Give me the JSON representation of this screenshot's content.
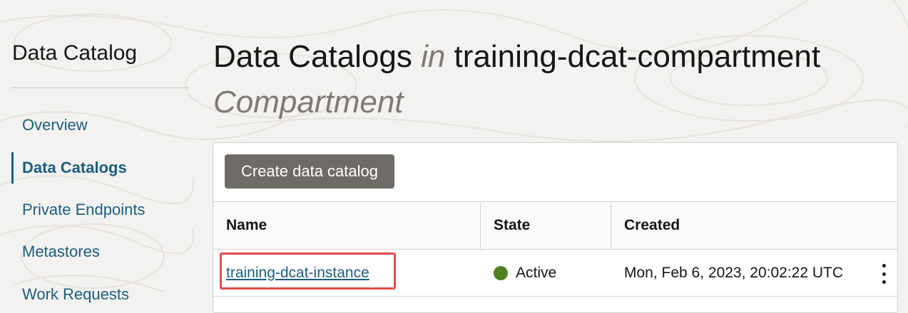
{
  "sidebar": {
    "title": "Data Catalog",
    "items": [
      {
        "label": "Overview",
        "active": false
      },
      {
        "label": "Data Catalogs",
        "active": true
      },
      {
        "label": "Private Endpoints",
        "active": false
      },
      {
        "label": "Metastores",
        "active": false
      },
      {
        "label": "Work Requests",
        "active": false
      }
    ]
  },
  "header": {
    "title_prefix": "Data Catalogs",
    "title_in": "in",
    "compartment_name": "training-dcat-compartment",
    "compartment_suffix": "Compartment"
  },
  "toolbar": {
    "create_label": "Create data catalog"
  },
  "table": {
    "columns": [
      "Name",
      "State",
      "Created"
    ],
    "rows": [
      {
        "name": "training-dcat-instance",
        "state": "Active",
        "created": "Mon, Feb 6, 2023, 20:02:22 UTC"
      }
    ]
  },
  "icons": {
    "status": "status-dot-icon",
    "row_actions": "kebab-menu-icon"
  },
  "colors": {
    "link": "#1a5e7e",
    "active_status": "#508223",
    "highlight": "#e04c4c",
    "button": "#6e6a66"
  }
}
